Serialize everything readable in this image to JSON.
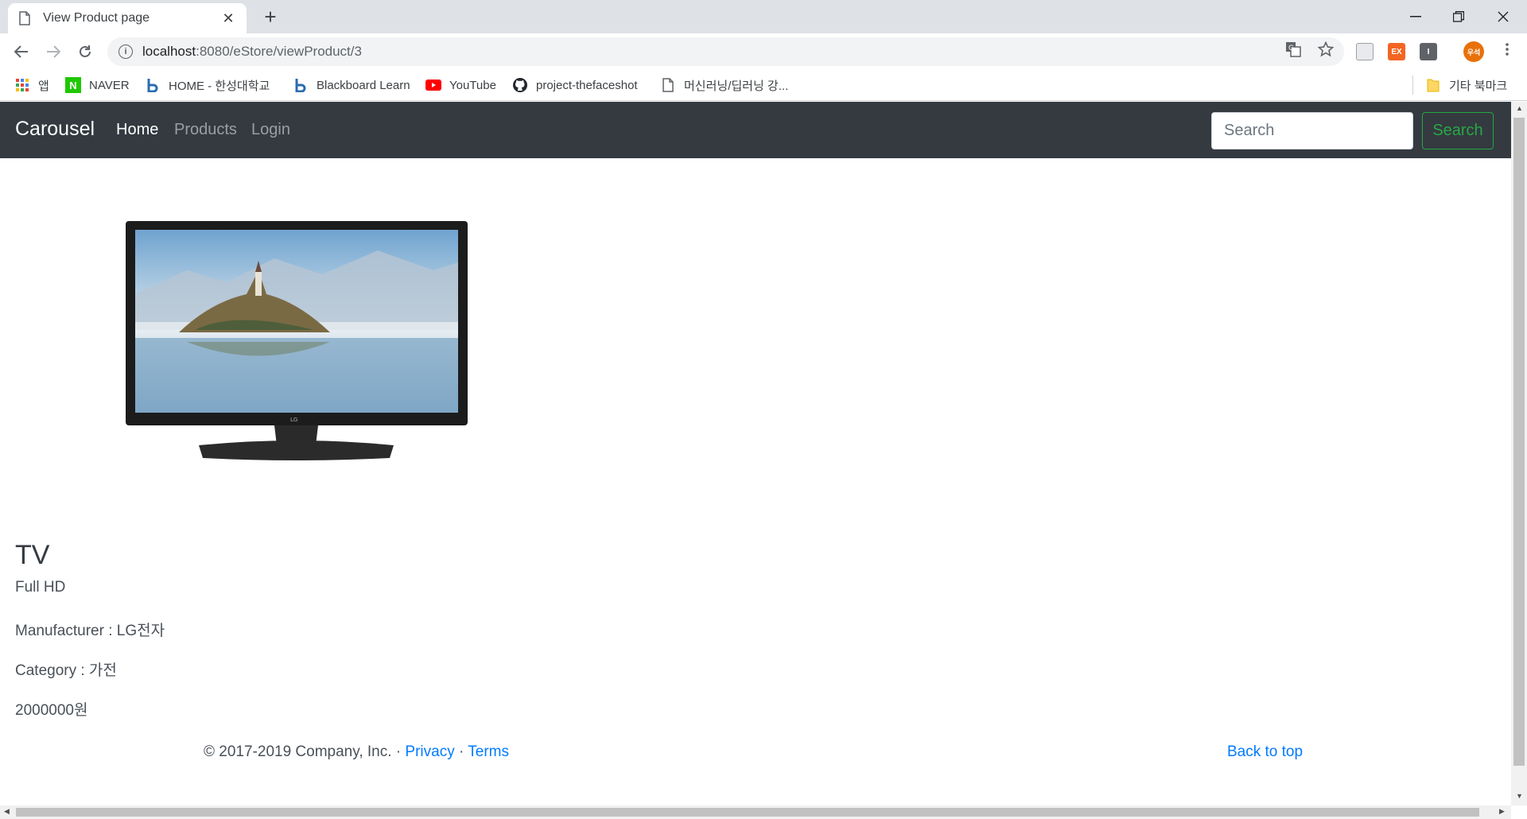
{
  "browser": {
    "tab_title": "View Product page",
    "url_host": "localhost",
    "url_path": ":8080/eStore/viewProduct/3",
    "profile_initials": "우석",
    "ext_label": "EX",
    "bookmarks": [
      {
        "label": "앱",
        "icon": "apps-grid-icon"
      },
      {
        "label": "NAVER",
        "icon": "naver-icon"
      },
      {
        "label": "HOME - 한성대학교",
        "icon": "blackboard-icon"
      },
      {
        "label": "Blackboard Learn",
        "icon": "blackboard-icon"
      },
      {
        "label": "YouTube",
        "icon": "youtube-icon"
      },
      {
        "label": "project-thefaceshot",
        "icon": "github-icon"
      },
      {
        "label": "머신러닝/딥러닝 강...",
        "icon": "page-icon"
      }
    ],
    "other_bookmarks": "기타 북마크"
  },
  "navbar": {
    "brand": "Carousel",
    "links": [
      {
        "label": "Home",
        "active": true
      },
      {
        "label": "Products",
        "active": false
      },
      {
        "label": "Login",
        "active": false
      }
    ],
    "search_placeholder": "Search",
    "search_button": "Search"
  },
  "product": {
    "name": "TV",
    "description": "Full HD",
    "manufacturer": "Manufacturer : LG전자",
    "category": "Category : 가전",
    "price": "2000000원"
  },
  "footer": {
    "copyright": "© 2017-2019 Company, Inc. · ",
    "privacy": "Privacy",
    "separator": " · ",
    "terms": "Terms",
    "back_to_top": "Back to top"
  },
  "colors": {
    "navbar_bg": "#343a40",
    "link_blue": "#007bff",
    "success_green": "#28a745"
  }
}
